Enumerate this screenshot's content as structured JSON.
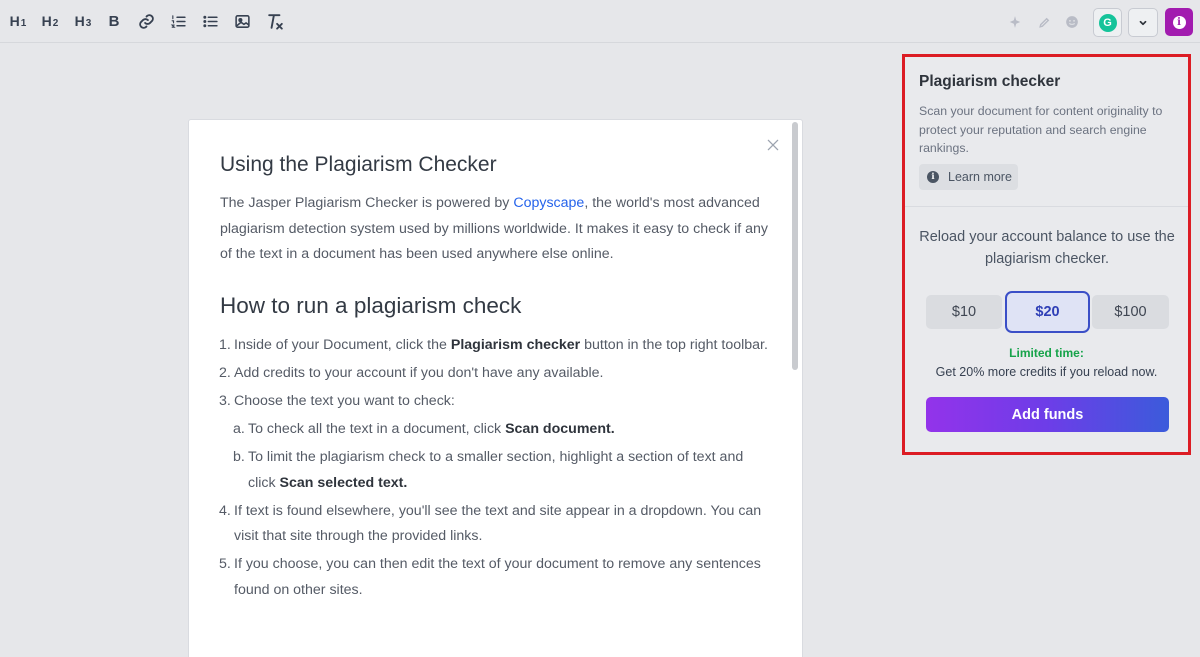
{
  "toolbar": {
    "h1": "H",
    "h1_sub": "1",
    "h2": "H",
    "h2_sub": "2",
    "h3": "H",
    "h3_sub": "3",
    "bold": "B",
    "grammarly_letter": "G",
    "info_letter": "i",
    "icons": [
      "heading-1-icon",
      "heading-2-icon",
      "heading-3-icon",
      "bold-icon",
      "link-icon",
      "ordered-list-icon",
      "bullet-list-icon",
      "image-icon",
      "clear-format-icon",
      "sparkle-icon",
      "pencil-icon",
      "emoji-icon",
      "grammarly-icon",
      "chevron-down-icon",
      "info-icon"
    ]
  },
  "modal": {
    "title": "Using the Plagiarism Checker",
    "intro_before": "The Jasper Plagiarism Checker is powered by ",
    "intro_link": "Copyscape",
    "intro_after": ", the world's most advanced plagiarism detection system used by millions worldwide. It makes it easy to check if any of the text in a document has been used anywhere else online.",
    "heading": "How to run a plagiarism check",
    "steps": [
      {
        "num": "1.",
        "before": "Inside of your Document, click the ",
        "bold": "Plagiarism checker",
        "after": " button in the top right toolbar."
      },
      {
        "num": "2.",
        "text": "Add credits to your account if you don't have any available."
      },
      {
        "num": "3.",
        "text": "Choose the text you want to check:"
      },
      {
        "num": "a.",
        "before": "To check all the text in a document, click ",
        "bold": "Scan document."
      },
      {
        "num": "b.",
        "before": "To limit the plagiarism check to a smaller section, highlight a section of text and click ",
        "bold": "Scan selected text."
      },
      {
        "num": "4.",
        "text": "If text is found elsewhere, you'll see the text and site appear in a dropdown. You can visit that site through the provided links."
      },
      {
        "num": "5.",
        "text": "If you choose, you can then edit the text of your document to remove any sentences found on other sites."
      }
    ]
  },
  "panel": {
    "title": "Plagiarism checker",
    "description": "Scan your document for content originality to protect your reputation and search engine rankings.",
    "learn_more": "Learn more",
    "reload_text": "Reload your account balance to use the plagiarism checker.",
    "amounts": [
      "$10",
      "$20",
      "$100"
    ],
    "selected_amount": "$20",
    "limited_time": "Limited time:",
    "promo": "Get 20% more credits if you reload now.",
    "add_funds": "Add funds",
    "colors": {
      "highlight_border": "#dc1c24",
      "selected": "#3b4fc7",
      "green": "#16a34a",
      "gradient_start": "#9333ea",
      "gradient_end": "#3b5bdb"
    }
  }
}
